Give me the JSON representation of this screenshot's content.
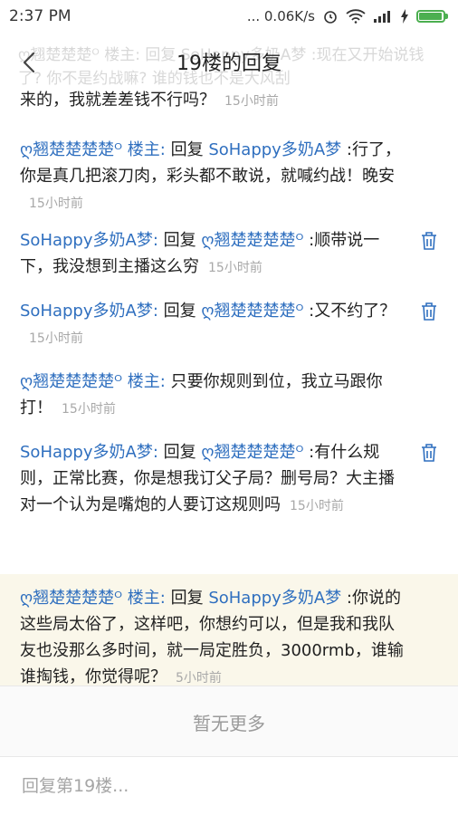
{
  "status_bar": {
    "time": "2:37 PM",
    "network_speed": "... 0.06K/s",
    "battery_level": 0.95
  },
  "header": {
    "title": "19楼的回复",
    "ghost_text": "ღ翘楚楚楚ᴼ 楼主: 回复 SoHappy多奶A梦 :现在又开始说钱了? 你不是约战嘛? 谁的钱也不是大风刮"
  },
  "replies": [
    {
      "body": "来的，我就差差钱不行吗？",
      "time": "15小时前",
      "deletable": false
    },
    {
      "author": "ღ翘楚楚楚楚ᴼ 楼主:",
      "verb": "回复",
      "target": "SoHappy多奶A梦",
      "body": ":行了，你是真几把滚刀肉，彩头都不敢说，就喊约战！晚安",
      "time": "15小时前",
      "deletable": false
    },
    {
      "author": "SoHappy多奶A梦:",
      "verb": "回复",
      "target": "ღ翘楚楚楚楚ᴼ",
      "body": ":顺带说一下，我没想到主播这么穷",
      "time": "15小时前",
      "deletable": true
    },
    {
      "author": "SoHappy多奶A梦:",
      "verb": "回复",
      "target": "ღ翘楚楚楚楚ᴼ",
      "body": ":又不约了？",
      "time": "15小时前",
      "deletable": true
    },
    {
      "author": "ღ翘楚楚楚楚ᴼ 楼主:",
      "verb": "",
      "target": "",
      "body": "只要你规则到位，我立马跟你打！",
      "time": "15小时前",
      "deletable": false
    },
    {
      "author": "SoHappy多奶A梦:",
      "verb": "回复",
      "target": "ღ翘楚楚楚楚ᴼ",
      "body": ":有什么规则，正常比赛，你是想我订父子局？删号局？大主播对一个认为是嘴炮的人要订这规则吗",
      "time": "15小时前",
      "deletable": true
    },
    {
      "author": "ღ翘楚楚楚楚ᴼ 楼主:",
      "verb": "回复",
      "target": "SoHappy多奶A梦",
      "body": ":你说的这些局太俗了，这样吧，你想约可以，但是我和我队友也没那么多时间，就一局定胜负，3000rmb，谁输谁掏钱，你觉得呢？",
      "time": "5小时前",
      "deletable": false,
      "highlighted": true
    }
  ],
  "footer": {
    "no_more": "暂无更多",
    "reply_placeholder": "回复第19楼..."
  }
}
